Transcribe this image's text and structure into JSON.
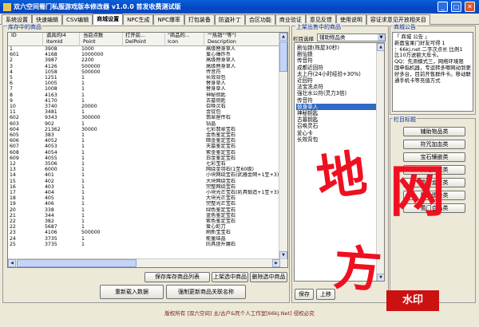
{
  "window": {
    "title": "双六空间蜀门私服游戏版本修改器 v1.0.0 首发收费测试版"
  },
  "tabs": [
    {
      "label": "系统设置"
    },
    {
      "label": "快速编辑"
    },
    {
      "label": "CSV编辑"
    },
    {
      "label": "商城设置",
      "active": true
    },
    {
      "label": "NPC生成"
    },
    {
      "label": "NPC爆率"
    },
    {
      "label": "打包装备"
    },
    {
      "label": "防盗补丁"
    },
    {
      "label": "合区功能"
    },
    {
      "label": "商业验证"
    },
    {
      "label": "意见反馈"
    },
    {
      "label": "使用说明"
    },
    {
      "label": "容证求意见开放相关目"
    }
  ],
  "goods": {
    "label": "库存中的商品",
    "headers_top": [
      "",
      "道具的I4",
      "当前点数",
      "打开前...",
      "\"商品的...",
      "\"\"热销\"\"等\")"
    ],
    "headers_bottom": [
      "ID",
      "ItemId",
      "Point",
      "DelPoint",
      "Icon",
      "Description"
    ],
    "rows": [
      [
        "1",
        "3908",
        "1000",
        "",
        "",
        "高级替身草人"
      ],
      [
        "601",
        "4168",
        "1000000",
        "",
        "",
        "爱心爆炸币"
      ],
      [
        "2",
        "3987",
        "2200",
        "",
        "",
        "高级替身草人"
      ],
      [
        "3",
        "4126",
        "500000",
        "",
        "",
        "高级替身草人"
      ],
      [
        "4",
        "1058",
        "500000",
        "",
        "",
        "传音符"
      ],
      [
        "5",
        "1251",
        "1",
        "",
        "",
        "长效背包"
      ],
      [
        "6",
        "1005",
        "1",
        "",
        "",
        "替身草人"
      ],
      [
        "7",
        "1008",
        "1",
        "",
        "",
        "替身草人"
      ],
      [
        "8",
        "4163",
        "1",
        "",
        "",
        "神秘钥匙"
      ],
      [
        "9",
        "4170",
        "1",
        "",
        "",
        "古墓钥匙"
      ],
      [
        "10",
        "3740",
        "20000",
        "",
        "",
        "召唤灵石"
      ],
      [
        "11",
        "3481",
        "1",
        "",
        "",
        "金锭包"
      ],
      [
        "602",
        "9343",
        "300000",
        "",
        "",
        "翡翠屋传石"
      ],
      [
        "603",
        "902",
        "1",
        "",
        "",
        "钻晶"
      ],
      [
        "604",
        "21362",
        "30000",
        "",
        "",
        "七彩翡翠宝石"
      ],
      [
        "605",
        "383",
        "1",
        "",
        "",
        "金色鉴定宝石"
      ],
      [
        "606",
        "4052",
        "1",
        "",
        "",
        "暗金鉴定宝石"
      ],
      [
        "607",
        "4053",
        "1",
        "",
        "",
        "天墓鉴定宝石"
      ],
      [
        "608",
        "4054",
        "1",
        "",
        "",
        "紫金鉴定宝石"
      ],
      [
        "609",
        "4055",
        "1",
        "",
        "",
        "白金鉴定宝石"
      ],
      [
        "12",
        "3506",
        "1",
        "",
        "",
        "七彩宝石"
      ],
      [
        "13",
        "6000",
        "1",
        "",
        "",
        "网绕金羽石(1至60级)"
      ],
      [
        "14",
        "401",
        "1",
        "",
        "",
        "小块网绕宝石(武器金网+1至+3)"
      ],
      [
        "15",
        "402",
        "1",
        "",
        "",
        "大块网绕宝石"
      ],
      [
        "16",
        "403",
        "1",
        "",
        "",
        "完整网绕宝石"
      ],
      [
        "17",
        "404",
        "1",
        "",
        "",
        "小块光芒宝石(防具锻造+1至+3)"
      ],
      [
        "18",
        "405",
        "1",
        "",
        "",
        "大块光芒宝石"
      ],
      [
        "19",
        "406",
        "1",
        "",
        "",
        "完整光芒宝石"
      ],
      [
        "20",
        "338",
        "1",
        "",
        "",
        "绿色鉴定宝石"
      ],
      [
        "21",
        "344",
        "1",
        "",
        "",
        "蓝色鉴定宝石"
      ],
      [
        "22",
        "382",
        "1",
        "",
        "",
        "紫色鉴定宝石"
      ],
      [
        "22",
        "5687",
        "1",
        "",
        "",
        "爱心蛇刀"
      ],
      [
        "23",
        "4106",
        "500000",
        "",
        "",
        "刷新宝宝石"
      ],
      [
        "24",
        "3735",
        "1",
        "",
        "",
        "能量结晶"
      ],
      [
        "25",
        "3735",
        "1",
        "",
        "",
        "防具提升魔石"
      ]
    ],
    "btn_save": "保存库存商品列表",
    "btn_add": "上架选中商品",
    "btn_delete": "删除选中商品",
    "btn_reload": "重新载入数据",
    "btn_force": "强制更新商品关联名称"
  },
  "sale": {
    "label": "上架出售中的商品",
    "category_label": "栏目选择",
    "category_value": "辅助物品类",
    "items": [
      {
        "text": "剧仙锁(阵屋30秒)"
      },
      {
        "text": "剧仙锁"
      },
      {
        "text": "传音符"
      },
      {
        "text": "成都近回符"
      },
      {
        "text": "太上丹(24小时经验+30%)"
      },
      {
        "text": "近回符"
      },
      {
        "text": "法宝洗点符"
      },
      {
        "text": "强壮水公符(灵力3倍)"
      },
      {
        "text": "传音符"
      },
      {
        "text": "替身草人",
        "selected": true
      },
      {
        "text": "神秘钥匙"
      },
      {
        "text": "古墓钥匙"
      },
      {
        "text": "召唤灵石"
      },
      {
        "text": "爱心卡"
      },
      {
        "text": "长效背包"
      }
    ],
    "btn_save": "保存",
    "btn_up": "上移"
  },
  "mall": {
    "label": "商城公告",
    "notice": "「 商城 公告 」\n新面宝果门好友可得 1\n：66kj.net 二字次点长 比例1\n比10万送额大年卡。\nQQ：先测模式三，网络环境限\n国申指机器，专运转多哪网动到更\n好多台，目前开售群件卡。移动联\n通手机卡等充值方式"
  },
  "columns": {
    "label": "栏目标题",
    "items": [
      "辅助物品类",
      "符咒加血类",
      "宝石镶嵌类",
      "仙宠养成类",
      "蜀门金货类",
      "帮会建设类",
      "蜀门合品类"
    ]
  },
  "footer": "版权所有 [双六空间] 主/古户&死个人工作室[66kj.Net] 侵权必究",
  "watermark": {
    "chars": [
      "地",
      "网",
      "方"
    ],
    "stamp": "水印"
  }
}
